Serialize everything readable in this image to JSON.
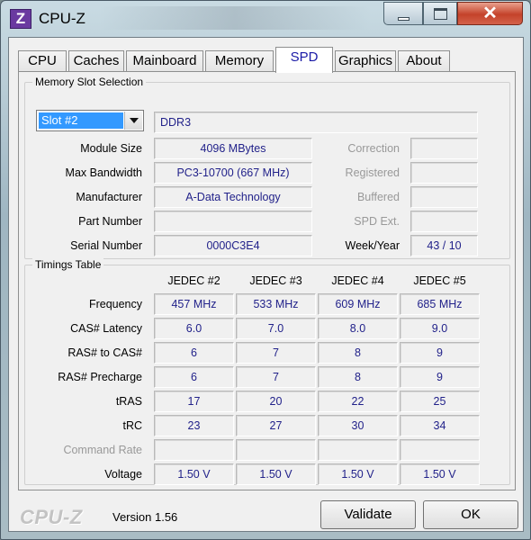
{
  "window": {
    "title": "CPU-Z",
    "app_icon_letter": "Z"
  },
  "tabs": [
    {
      "label": "CPU"
    },
    {
      "label": "Caches"
    },
    {
      "label": "Mainboard"
    },
    {
      "label": "Memory"
    },
    {
      "label": "SPD",
      "active": true
    },
    {
      "label": "Graphics"
    },
    {
      "label": "About"
    }
  ],
  "slot": {
    "group_title": "Memory Slot Selection",
    "selected": "Slot #2",
    "type": "DDR3",
    "rows": [
      {
        "label": "Module Size",
        "value": "4096 MBytes",
        "right_label": "Correction",
        "right_value": ""
      },
      {
        "label": "Max Bandwidth",
        "value": "PC3-10700 (667 MHz)",
        "right_label": "Registered",
        "right_value": ""
      },
      {
        "label": "Manufacturer",
        "value": "A-Data Technology",
        "right_label": "Buffered",
        "right_value": ""
      },
      {
        "label": "Part Number",
        "value": "",
        "right_label": "SPD Ext.",
        "right_value": ""
      },
      {
        "label": "Serial Number",
        "value": "0000C3E4",
        "right_label": "Week/Year",
        "right_value": "43 / 10"
      }
    ]
  },
  "timings": {
    "group_title": "Timings Table",
    "columns": [
      "JEDEC #2",
      "JEDEC #3",
      "JEDEC #4",
      "JEDEC #5"
    ],
    "rows": [
      {
        "label": "Frequency",
        "values": [
          "457 MHz",
          "533 MHz",
          "609 MHz",
          "685 MHz"
        ]
      },
      {
        "label": "CAS# Latency",
        "values": [
          "6.0",
          "7.0",
          "8.0",
          "9.0"
        ]
      },
      {
        "label": "RAS# to CAS#",
        "values": [
          "6",
          "7",
          "8",
          "9"
        ]
      },
      {
        "label": "RAS# Precharge",
        "values": [
          "6",
          "7",
          "8",
          "9"
        ]
      },
      {
        "label": "tRAS",
        "values": [
          "17",
          "20",
          "22",
          "25"
        ]
      },
      {
        "label": "tRC",
        "values": [
          "23",
          "27",
          "30",
          "34"
        ]
      },
      {
        "label": "Command Rate",
        "values": [
          "",
          "",
          "",
          ""
        ]
      },
      {
        "label": "Voltage",
        "values": [
          "1.50 V",
          "1.50 V",
          "1.50 V",
          "1.50 V"
        ]
      }
    ]
  },
  "footer": {
    "logo": "CPU-Z",
    "version": "Version 1.56",
    "validate_label": "Validate",
    "ok_label": "OK"
  }
}
